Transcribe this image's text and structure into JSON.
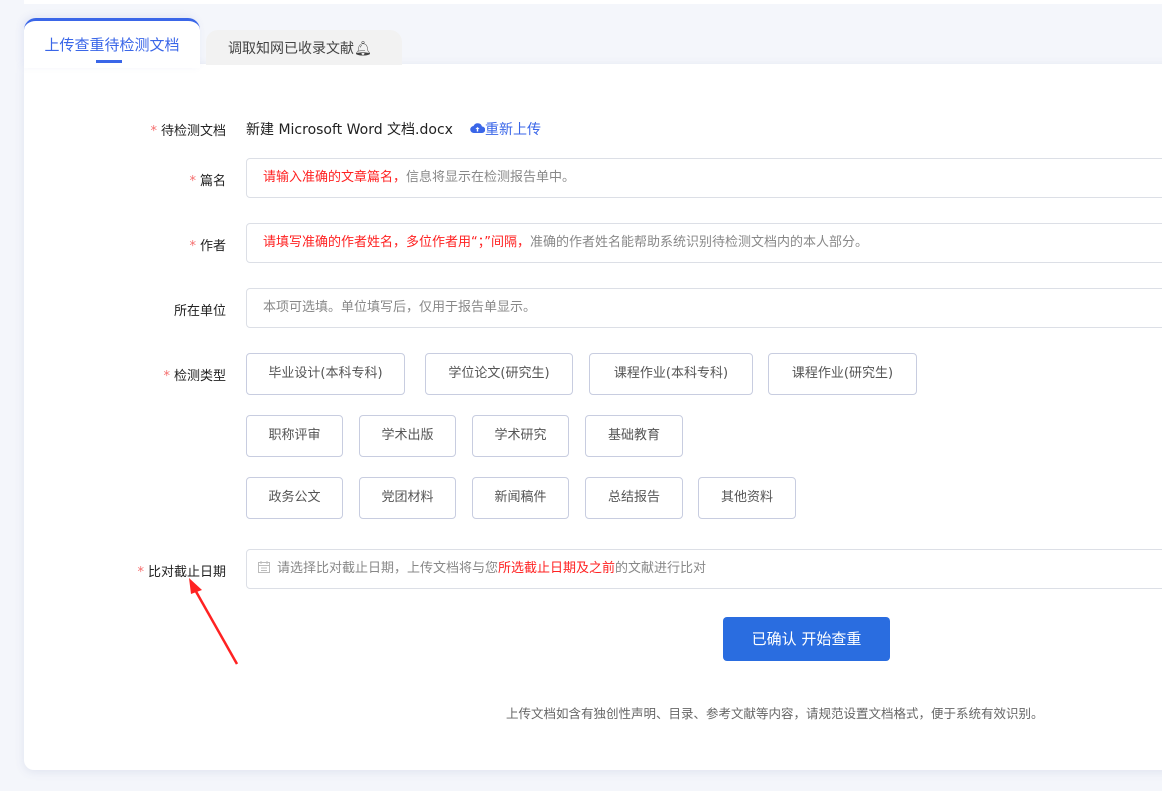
{
  "tabs": [
    {
      "label": "上传查重待检测文档",
      "active": true
    },
    {
      "label": "调取知网已收录文献"
    }
  ],
  "form": {
    "document": {
      "label": "待检测文档",
      "filename": "新建 Microsoft Word 文档.docx",
      "reupload": "重新上传"
    },
    "title": {
      "label": "篇名",
      "placeholder_red": "请输入准确的文章篇名，",
      "placeholder_gray": "信息将显示在检测报告单中。"
    },
    "author": {
      "label": "作者",
      "placeholder_red": "请填写准确的作者姓名，多位作者用“；”间隔，",
      "placeholder_gray": "准确的作者姓名能帮助系统识别待检测文档内的本人部分。"
    },
    "unit": {
      "label": "所在单位",
      "placeholder": "本项可选填。单位填写后，仅用于报告单显示。"
    },
    "type": {
      "label": "检测类型",
      "options": [
        "毕业设计(本科专科)",
        "学位论文(研究生)",
        "课程作业(本科专科)",
        "课程作业(研究生)",
        "职称评审",
        "学术出版",
        "学术研究",
        "基础教育",
        "政务公文",
        "党团材料",
        "新闻稿件",
        "总结报告",
        "其他资料"
      ]
    },
    "date": {
      "label": "比对截止日期",
      "placeholder_a": "请选择比对截止日期，上传文档将与您",
      "placeholder_red": "所选截止日期及之前",
      "placeholder_b": "的文献进行比对"
    },
    "confirm": "已确认 开始查重",
    "note": "上传文档如含有独创性声明、目录、参考文献等内容，请规范设置文档格式，便于系统有效识别。"
  },
  "colors": {
    "accent": "#3a66e8",
    "button": "#2a6de0",
    "required": "#f56c6c",
    "warn": "#ff2222"
  }
}
